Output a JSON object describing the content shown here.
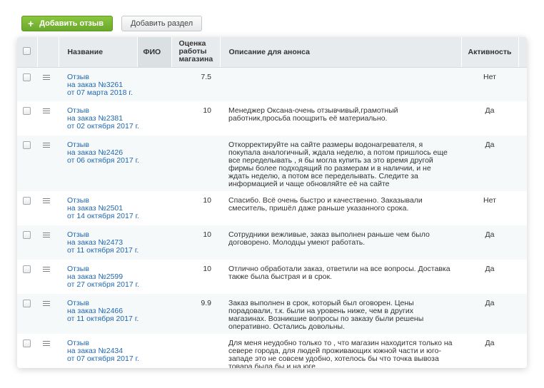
{
  "toolbar": {
    "add_review_label": "Добавить отзыв",
    "add_section_label": "Добавить раздел"
  },
  "table": {
    "columns": {
      "name": "Название",
      "fio": "ФИО",
      "rating_l1": "Оценка",
      "rating_l2": "работы",
      "rating_l3": "магазина",
      "description": "Описание для анонса",
      "active": "Активность"
    },
    "rows": [
      {
        "title": "Отзыв",
        "order": "на заказ №3261",
        "date": "от 07 марта 2018 г.",
        "fio": "",
        "rating": "7.5",
        "desc": "",
        "active": "Нет"
      },
      {
        "title": "Отзыв",
        "order": "на заказ №2381",
        "date": "от 02 октября 2017 г.",
        "fio": "",
        "rating": "10",
        "desc": "Менеджер Оксана-очень отзывчивый,грамотный работник,просьба поощрить её материально.",
        "active": "Да"
      },
      {
        "title": "Отзыв",
        "order": "на заказ №2426",
        "date": "от 06 октября 2017 г.",
        "fio": "",
        "rating": "",
        "desc": "Откорректируйте на сайте размеры водонагревателя, я покупала аналогичный, ждала неделю, а потом пришлось еще все переделывать , я бы могла купить за это время другой фирмы более подходящий по размерам и в наличии, и не ждать неделю, а потом все переделывать. Следите за информацией и чаще обновляйте её на сайте",
        "active": "Да"
      },
      {
        "title": "Отзыв",
        "order": "на заказ №2501",
        "date": "от 14 октября 2017 г.",
        "fio": "",
        "rating": "10",
        "desc": "Спасибо. Всё очень быстро и качественно. Заказывали смеситель, пришёл даже раньше указанного срока.",
        "active": "Нет"
      },
      {
        "title": "Отзыв",
        "order": "на заказ №2473",
        "date": "от 11 октября 2017 г.",
        "fio": "",
        "rating": "10",
        "desc": "Сотрудники вежливые, заказ выполнен раньше чем было договорено. Молодцы умеют работать.",
        "active": "Да"
      },
      {
        "title": "Отзыв",
        "order": "на заказ №2599",
        "date": "от 27 октября 2017 г.",
        "fio": "",
        "rating": "10",
        "desc": "Отлично обработали заказ, ответили на все вопросы. Доставка также была быстрая и в срок.",
        "active": "Да"
      },
      {
        "title": "Отзыв",
        "order": "на заказ №2466",
        "date": "от 11 октября 2017 г.",
        "fio": "",
        "rating": "9.9",
        "desc": "Заказ выполнен в срок, который был оговорен. Цены порадовали, т.к. были на уровень ниже, чем в других магазинах. Возникшие вопросы по заказу были решены оперативно. Остались довольны.",
        "active": "Да"
      },
      {
        "title": "Отзыв",
        "order": "на заказ №2434",
        "date": "от 07 октября 2017 г.",
        "fio": "",
        "rating": "",
        "desc": "Для меня неудобно только то , что магазин находится только на севере города, для людей проживающих южной части и юго- западе это не совсем удобно, хотелось бы что точка вывоза товара была бы и на юге.",
        "active": "Да"
      }
    ]
  }
}
